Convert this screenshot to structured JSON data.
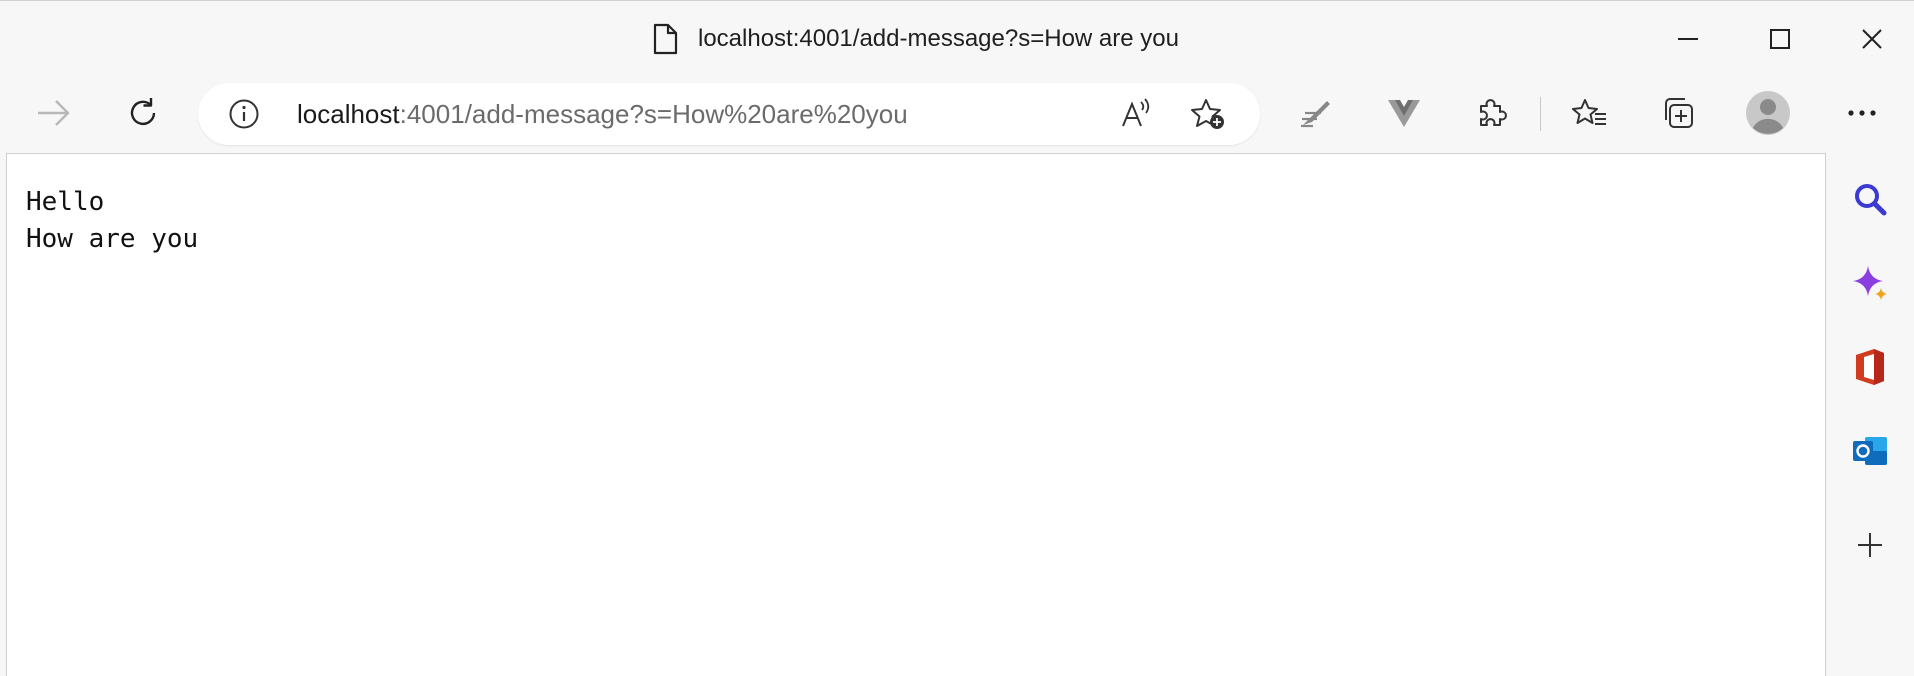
{
  "window": {
    "title": "localhost:4001/add-message?s=How are you"
  },
  "toolbar": {
    "address_host": "localhost",
    "address_rest": ":4001/add-message?s=How%20are%20you"
  },
  "page": {
    "lines": [
      "Hello",
      "How are you"
    ]
  },
  "icons": {
    "title": "file-icon",
    "forward": "arrow-right-icon",
    "refresh": "refresh-icon",
    "info": "info-icon",
    "read_aloud": "read-aloud-icon",
    "favorite_add": "star-add-icon",
    "extension_1": "pen-extension-icon",
    "extension_2": "vue-devtools-icon",
    "extensions": "puzzle-icon",
    "favorites": "favorites-list-icon",
    "collections": "collections-icon",
    "profile": "avatar-icon",
    "more": "ellipsis-icon",
    "sidebar": [
      "search-icon",
      "copilot-icon",
      "office-icon",
      "outlook-icon",
      "plus-icon"
    ]
  },
  "colors": {
    "search": "#3b3bd4",
    "copilot": "#8b3fe0",
    "office": "#d13b1f",
    "outlook": "#0f6cbd"
  }
}
